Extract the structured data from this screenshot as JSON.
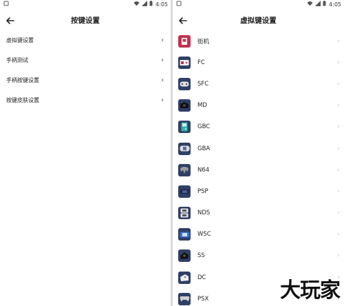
{
  "status": {
    "time": "4:05"
  },
  "left": {
    "title": "按键设置",
    "items": [
      {
        "label": "虚拟键设置",
        "chevron": "›"
      },
      {
        "label": "手柄测试",
        "chevron": "›"
      },
      {
        "label": "手柄按键设置",
        "chevron": "›"
      },
      {
        "label": "按键皮肤设置",
        "chevron": "›"
      }
    ]
  },
  "right": {
    "title": "虚拟键设置",
    "systems": [
      {
        "label": "街机",
        "icon": "arcade-icon",
        "color": "#c0334f"
      },
      {
        "label": "FC",
        "icon": "fc-console-icon",
        "color": "#2f3f66"
      },
      {
        "label": "SFC",
        "icon": "sfc-controller-icon",
        "color": "#2f3f66"
      },
      {
        "label": "MD",
        "icon": "md-console-icon",
        "color": "#2f3f66"
      },
      {
        "label": "GBC",
        "icon": "gbc-handheld-icon",
        "color": "#2f3f66"
      },
      {
        "label": "GBA",
        "icon": "gba-handheld-icon",
        "color": "#2f3f66"
      },
      {
        "label": "N64",
        "icon": "n64-controller-icon",
        "color": "#2f3f66"
      },
      {
        "label": "PSP",
        "icon": "psp-handheld-icon",
        "color": "#2f3f66"
      },
      {
        "label": "NDS",
        "icon": "nds-handheld-icon",
        "color": "#2f3f66"
      },
      {
        "label": "WSC",
        "icon": "wsc-handheld-icon",
        "color": "#2f3f66"
      },
      {
        "label": "SS",
        "icon": "ss-console-icon",
        "color": "#2f3f66"
      },
      {
        "label": "DC",
        "icon": "dc-console-icon",
        "color": "#2f3f66"
      },
      {
        "label": "PSX",
        "icon": "psx-controller-icon",
        "color": "#2f3f66"
      }
    ]
  },
  "watermark": "大玩家"
}
